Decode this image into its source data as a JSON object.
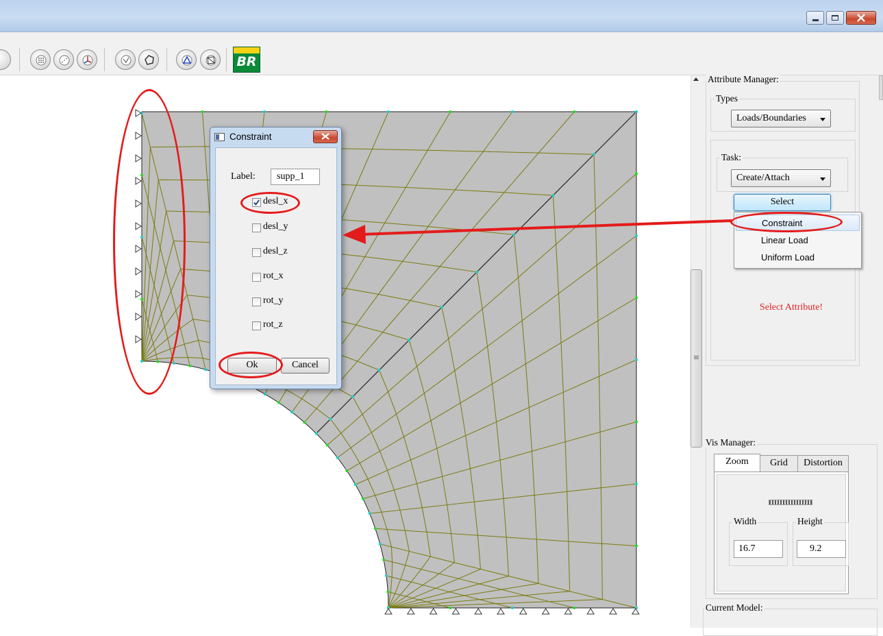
{
  "toolbar": {
    "logo_text": "BR"
  },
  "dialog": {
    "title": "Constraint",
    "label_caption": "Label:",
    "label_value": "supp_1",
    "options": [
      {
        "label": "desl_x",
        "checked": true
      },
      {
        "label": "desl_y",
        "checked": false
      },
      {
        "label": "desl_z",
        "checked": false
      },
      {
        "label": "rot_x",
        "checked": false
      },
      {
        "label": "rot_y",
        "checked": false
      },
      {
        "label": "rot_z",
        "checked": false
      }
    ],
    "ok_label": "Ok",
    "cancel_label": "Cancel"
  },
  "attribute_manager": {
    "title": "Attribute Manager:",
    "types_label": "Types",
    "types_value": "Loads/Boundaries",
    "task_label": "Task:",
    "task_value": "Create/Attach",
    "select_label": "Select",
    "menu_items": [
      "Constraint",
      "Linear Load",
      "Uniform Load"
    ],
    "highlighted_item": "Constraint",
    "message": "Select Attribute!"
  },
  "vis_manager": {
    "title": "Vis Manager:",
    "tabs": [
      "Zoom",
      "Grid",
      "Distortion"
    ],
    "active_tab": "Zoom",
    "width_label": "Width",
    "width_value": "16.7",
    "height_label": "Height",
    "height_value": "9.2"
  },
  "current_model_label": "Current Model:",
  "colors": {
    "mesh_fill": "#c0c0c0",
    "mesh_line": "#7a7a10",
    "node_green": "#22dd22",
    "node_cyan": "#22cccc",
    "annotation_red": "#e41b1b",
    "warning_red": "#e02020"
  }
}
